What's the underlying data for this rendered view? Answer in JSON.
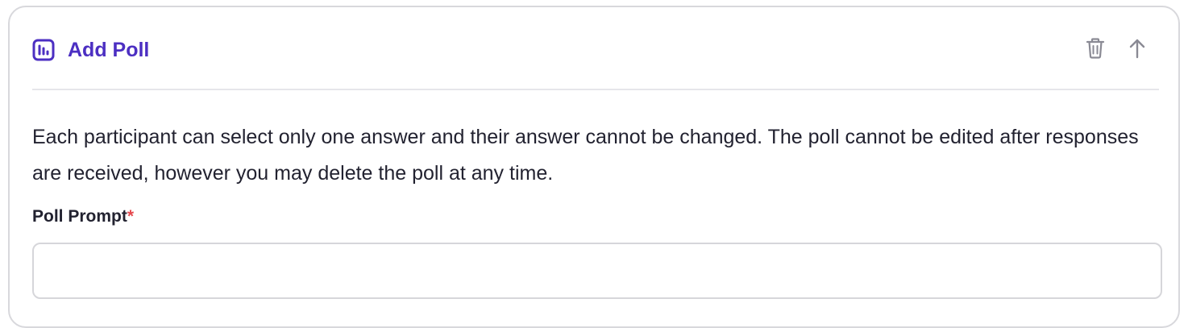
{
  "header": {
    "title": "Add Poll",
    "title_icon": "poll-chart-icon",
    "actions": [
      {
        "name": "delete",
        "icon": "trash-icon"
      },
      {
        "name": "move-up",
        "icon": "arrow-up-icon"
      }
    ]
  },
  "description": "Each participant can select only one answer and their answer cannot be changed. The poll cannot be edited after responses are received, however you may delete the poll at any time.",
  "poll_prompt": {
    "label": "Poll Prompt",
    "required_mark": "*",
    "value": "",
    "placeholder": ""
  },
  "colors": {
    "accent": "#4c2fc2",
    "required": "#e5484d",
    "icon_muted": "#8a8a94",
    "border": "#d8d8dc"
  }
}
